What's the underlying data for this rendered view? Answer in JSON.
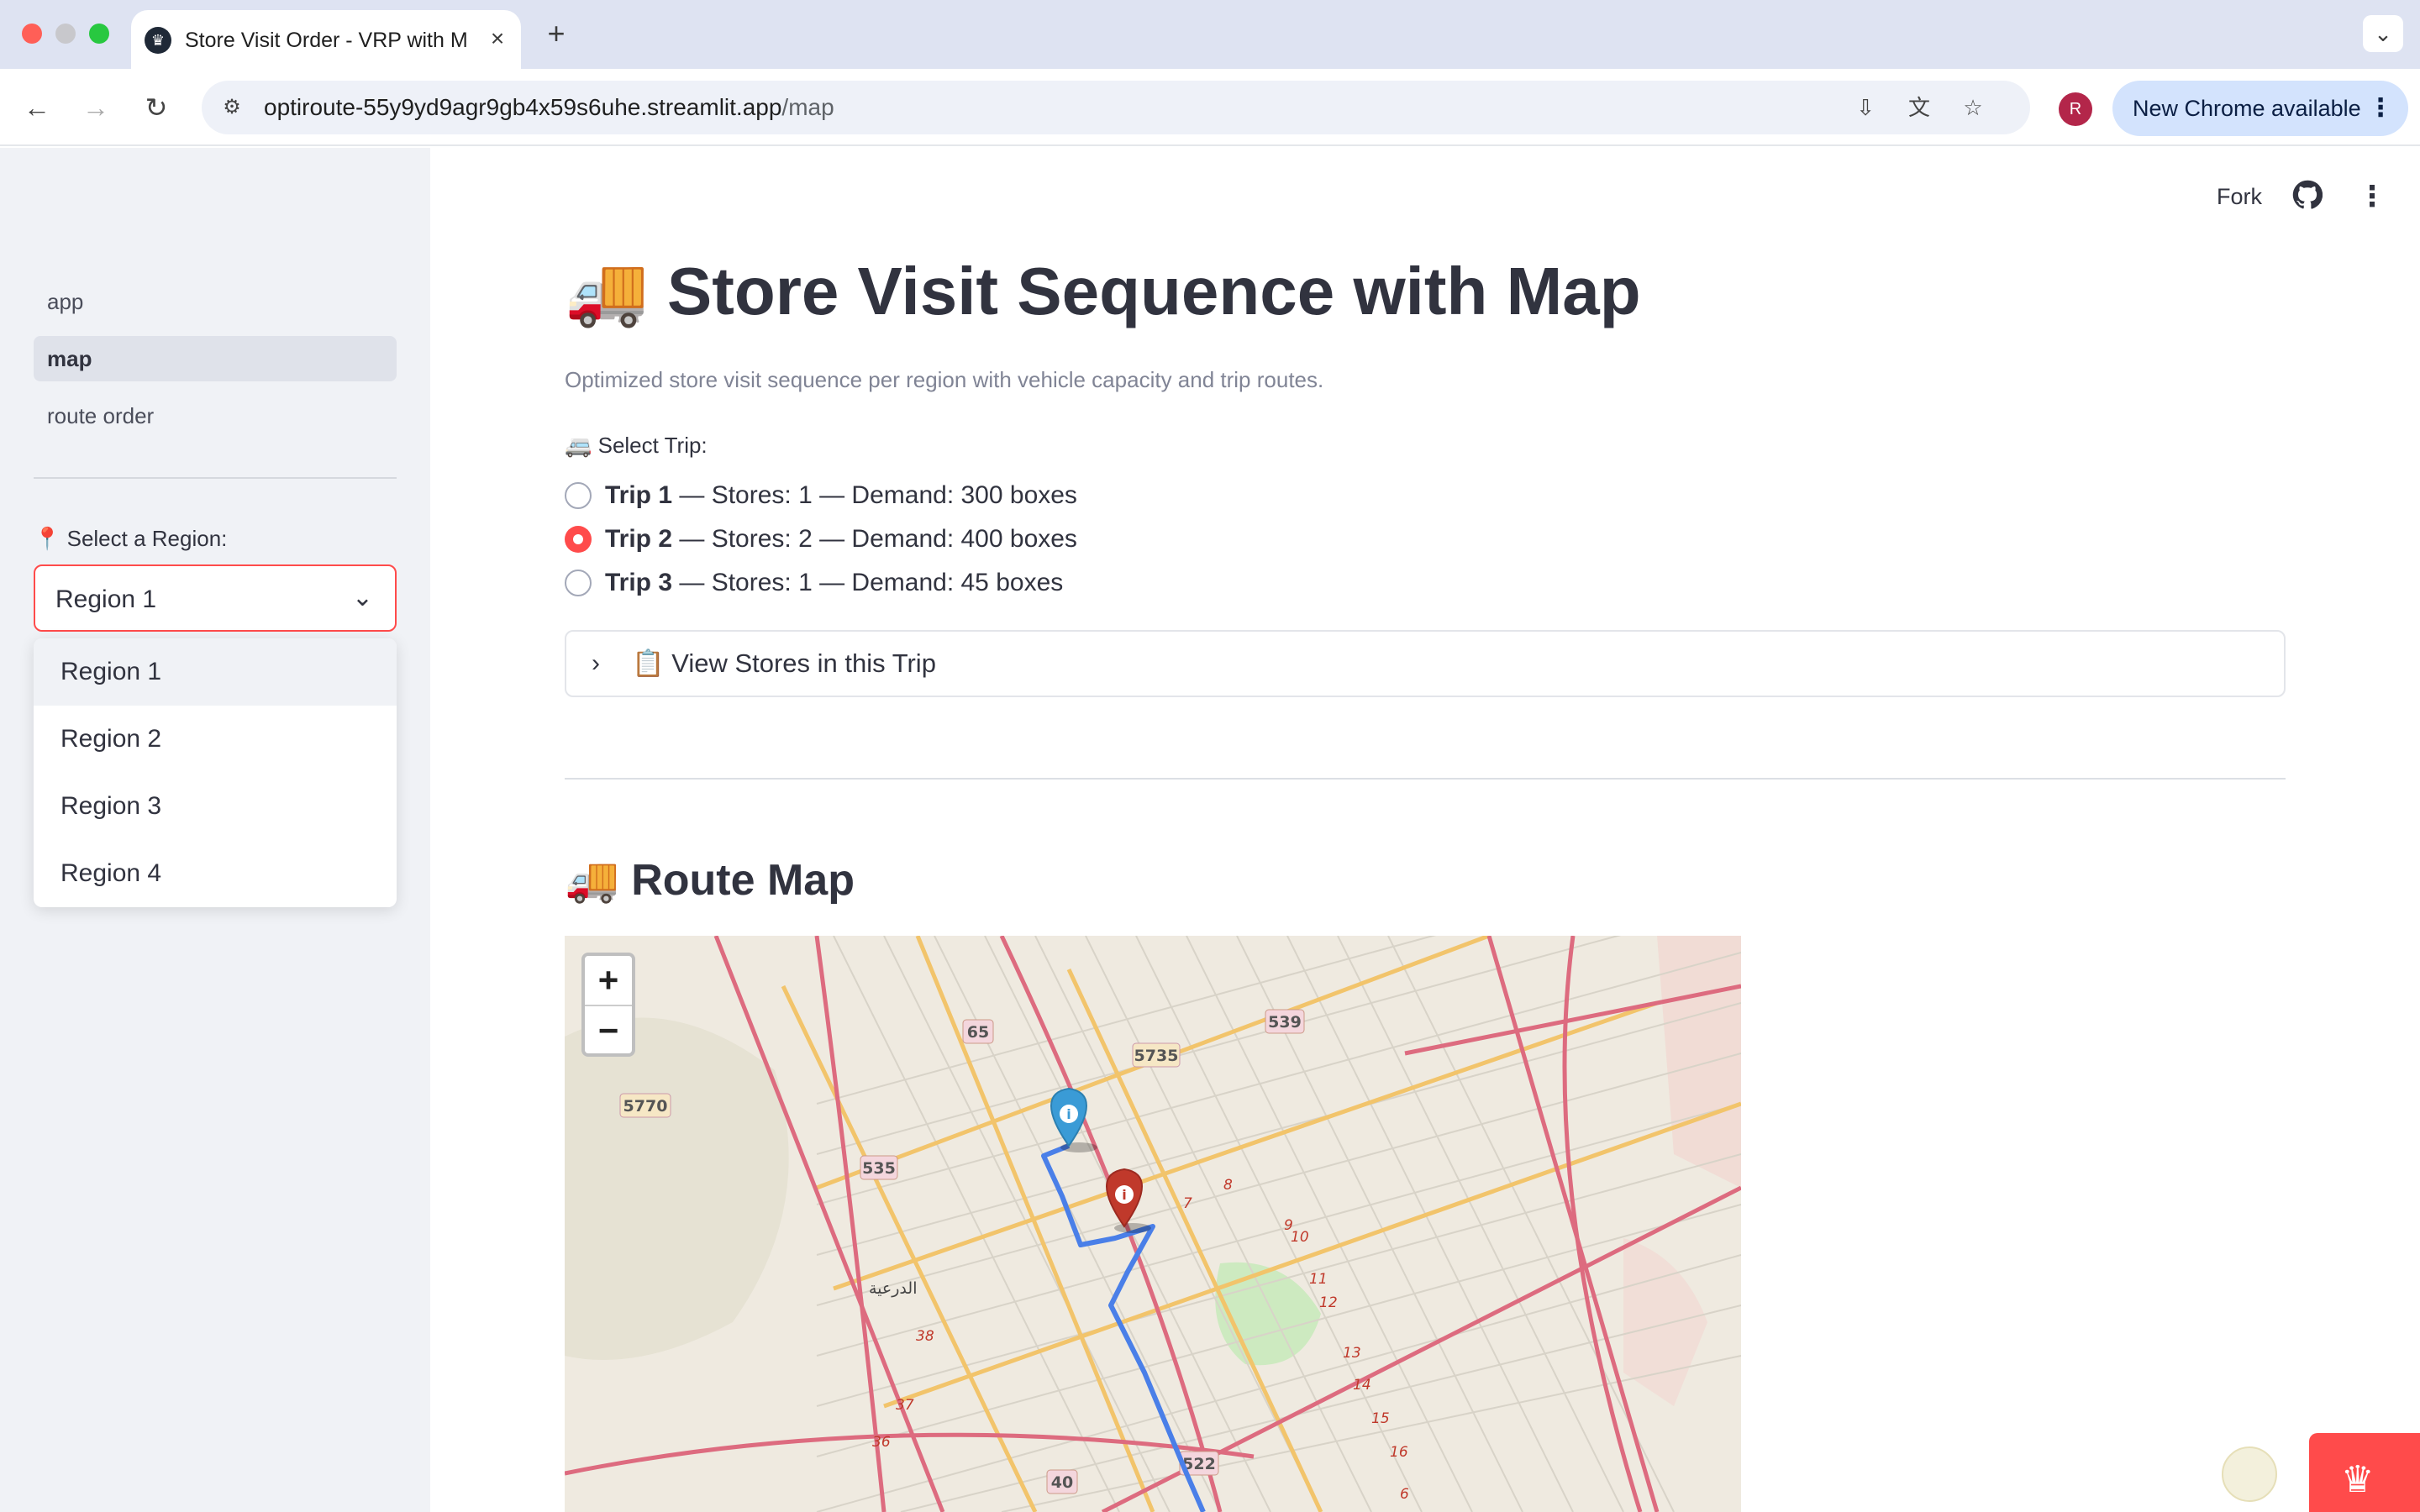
{
  "browser": {
    "tab_title": "Store Visit Order - VRP with M",
    "url_host": "optiroute-55y9yd9agr9gb4x59s6uhe.streamlit.app",
    "url_path": "/map",
    "profile_initial": "R",
    "update_label": "New Chrome available"
  },
  "header": {
    "fork_label": "Fork"
  },
  "sidebar": {
    "nav": [
      {
        "label": "app",
        "active": false
      },
      {
        "label": "map",
        "active": true
      },
      {
        "label": "route order",
        "active": false
      }
    ],
    "region_label": "📍 Select a Region:",
    "region_value": "Region 1",
    "region_options": [
      "Region 1",
      "Region 2",
      "Region 3",
      "Region 4"
    ]
  },
  "main": {
    "title": "🚚 Store Visit Sequence with Map",
    "subtitle": "Optimized store visit sequence per region with vehicle capacity and trip routes.",
    "trip_label": "🚐 Select Trip:",
    "trips": [
      {
        "name": "Trip 1",
        "detail": " — Stores: 1 — Demand: 300 boxes",
        "selected": false
      },
      {
        "name": "Trip 2",
        "detail": " — Stores: 2 — Demand: 400 boxes",
        "selected": true
      },
      {
        "name": "Trip 3",
        "detail": " — Stores: 1 — Demand: 45 boxes",
        "selected": false
      }
    ],
    "expander_label": "📋 View Stores in this Trip",
    "map_title": "🚚 Route Map"
  },
  "map": {
    "zoom_in": "+",
    "zoom_out": "−",
    "road_labels": [
      "65",
      "5735",
      "539",
      "5770",
      "535",
      "522",
      "40",
      "الدرعية",
      "36",
      "37",
      "38",
      "9",
      "10",
      "11",
      "12",
      "13",
      "14",
      "15",
      "16",
      "6",
      "7",
      "8"
    ],
    "route_color": "#4a7fe8",
    "marker_colors": {
      "start": "#3a9bd6",
      "stop": "#c0392b"
    }
  }
}
